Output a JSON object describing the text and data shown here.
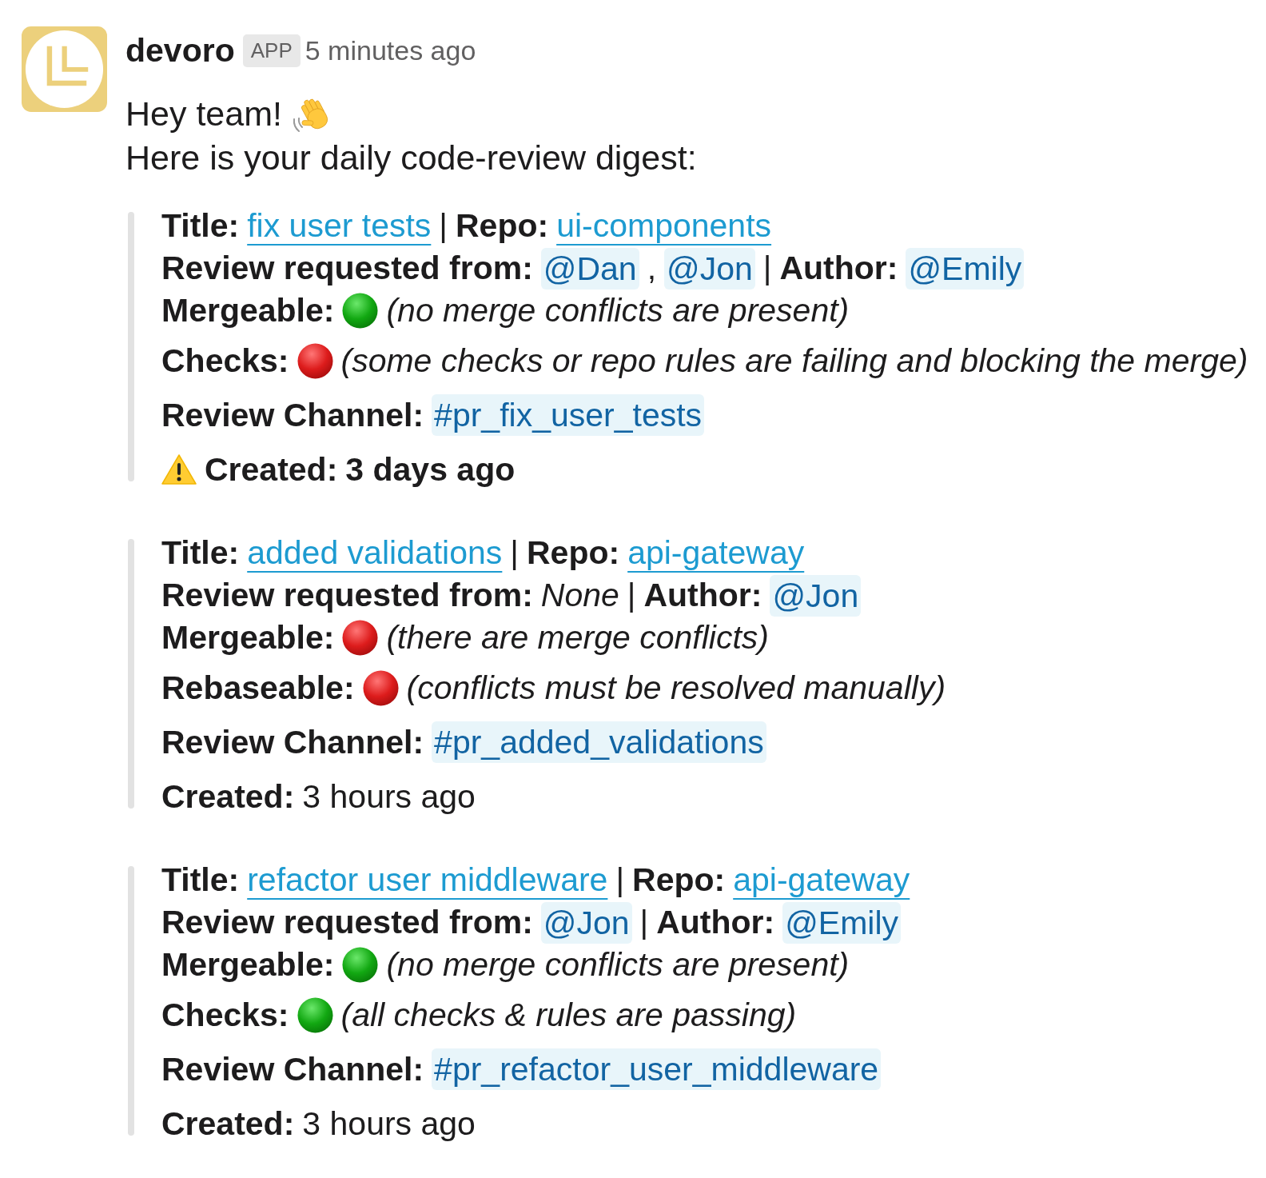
{
  "message": {
    "author": "devoro",
    "badge": "APP",
    "time": "5 minutes ago",
    "greeting": "Hey team!",
    "intro": "Here is your daily code-review digest:"
  },
  "pull_requests": [
    {
      "title_label": "Title:",
      "title": "fix user tests",
      "separator": "|",
      "repo_label": "Repo:",
      "repo": "ui-components",
      "review": {
        "label": "Review requested from:",
        "reviewers": [
          {
            "kind": "mention",
            "text": "@Dan"
          },
          {
            "kind": "plain",
            "text": ","
          },
          {
            "kind": "mention",
            "text": "@Jon"
          }
        ],
        "separator": "|",
        "author_label": "Author:",
        "author": "@Emily"
      },
      "statuses": [
        {
          "label": "Mergeable:",
          "passing": true,
          "note": "(no merge conflicts are present)"
        },
        {
          "label": "Checks:",
          "passing": false,
          "note": "(some checks or repo rules are failing and blocking the merge)"
        }
      ],
      "channel": {
        "label": "Review Channel:",
        "name": "#pr_fix_user_tests"
      },
      "created": {
        "label": "Created:",
        "value": "3 days ago",
        "stale": true
      }
    },
    {
      "title_label": "Title:",
      "title": "added validations",
      "separator": "|",
      "repo_label": "Repo:",
      "repo": "api-gateway",
      "review": {
        "label": "Review requested from:",
        "reviewers": [
          {
            "kind": "emphasis",
            "text": "None"
          }
        ],
        "separator": "|",
        "author_label": "Author:",
        "author": "@Jon"
      },
      "statuses": [
        {
          "label": "Mergeable:",
          "passing": false,
          "note": "(there are merge conflicts)"
        },
        {
          "label": "Rebaseable:",
          "passing": false,
          "note": "(conflicts must be resolved manually)"
        }
      ],
      "channel": {
        "label": "Review Channel:",
        "name": "#pr_added_validations"
      },
      "created": {
        "label": "Created:",
        "value": "3 hours ago",
        "stale": false
      }
    },
    {
      "title_label": "Title:",
      "title": "refactor user middleware",
      "separator": "|",
      "repo_label": "Repo:",
      "repo": "api-gateway",
      "review": {
        "label": "Review requested from:",
        "reviewers": [
          {
            "kind": "mention",
            "text": "@Jon"
          }
        ],
        "separator": "|",
        "author_label": "Author:",
        "author": "@Emily"
      },
      "statuses": [
        {
          "label": "Mergeable:",
          "passing": true,
          "note": "(no merge conflicts are present)"
        },
        {
          "label": "Checks:",
          "passing": true,
          "note": "(all checks & rules are passing)"
        }
      ],
      "channel": {
        "label": "Review Channel:",
        "name": "#pr_refactor_user_middleware"
      },
      "created": {
        "label": "Created:",
        "value": "3 hours ago",
        "stale": false
      }
    }
  ]
}
